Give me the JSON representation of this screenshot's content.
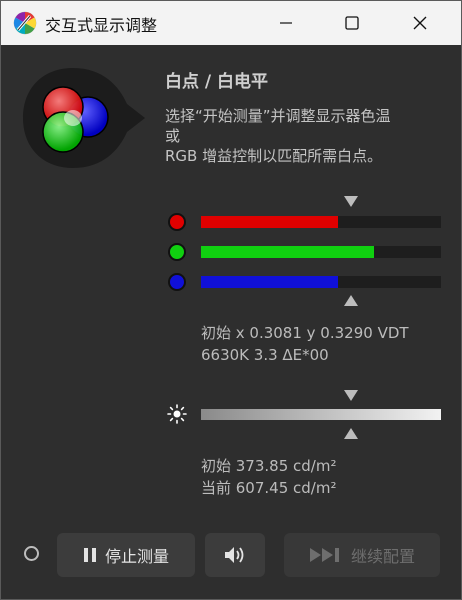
{
  "window": {
    "title": "交互式显示调整"
  },
  "panel": {
    "heading": "白点 / 白电平",
    "description_lines": [
      "选择“开始测量”并调整显示器色温",
      "或",
      "RGB 增益控制以匹配所需白点。"
    ]
  },
  "rgb_bars": {
    "red": {
      "level": 0.57,
      "color": "#e00000"
    },
    "green": {
      "level": 0.72,
      "color": "#10d010"
    },
    "blue": {
      "level": 0.57,
      "color": "#1010d8"
    }
  },
  "white_point_readout": {
    "line1": "初始 x 0.3081 y 0.3290 VDT",
    "line2": "6630K 3.3 ΔE*00"
  },
  "luminance_readout": {
    "initial": "初始 373.85 cd/m²",
    "current": "当前 607.45 cd/m²"
  },
  "buttons": {
    "stop": "停止测量",
    "continue": "继续配置"
  },
  "icons": {
    "app": "color-wheel-icon",
    "minimize": "minimize-icon",
    "maximize": "maximize-icon",
    "close": "close-icon",
    "pause": "pause-icon",
    "sound": "speaker-icon",
    "skip": "skip-forward-icon",
    "brightness": "sun-icon"
  }
}
